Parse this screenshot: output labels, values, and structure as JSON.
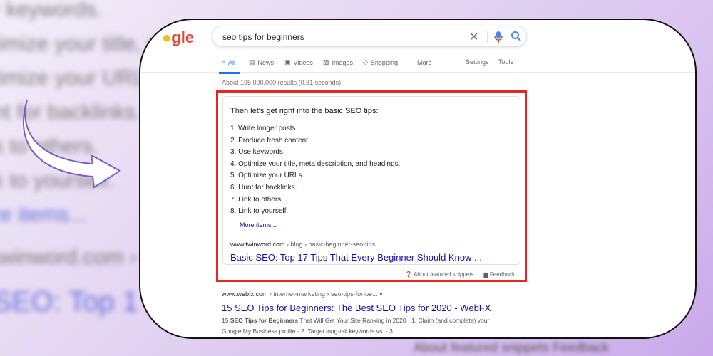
{
  "background": {
    "lines": [
      "r keywords.",
      "timize your title, m",
      "timize your URLs.",
      "nt for backlinks.",
      "k to others.",
      "k to yourself."
    ],
    "more": "re items...",
    "cite": "twinword.com › blo",
    "title": "SEO: Top 1",
    "bottom": "About featured snippets   Feedback"
  },
  "logo": "gle",
  "search": {
    "query": "seo tips for beginners"
  },
  "tabs": [
    {
      "label": "All",
      "icon": "search-icon"
    },
    {
      "label": "News",
      "icon": "news-icon"
    },
    {
      "label": "Videos",
      "icon": "video-icon"
    },
    {
      "label": "Images",
      "icon": "image-icon"
    },
    {
      "label": "Shopping",
      "icon": "tag-icon"
    },
    {
      "label": "More",
      "icon": "more-vert-icon"
    }
  ],
  "settings": "Settings",
  "tools": "Tools",
  "stats": "About 195,000,000 results (0.81 seconds)",
  "snippet": {
    "heading": "Then let's get right into the basic SEO tips:",
    "items": [
      "1. Write longer posts.",
      "2. Produce fresh content.",
      "3. Use keywords.",
      "4. Optimize your title, meta description, and headings.",
      "5. Optimize your URLs.",
      "6. Hunt for backlinks.",
      "7. Link to others.",
      "8. Link to yourself."
    ],
    "more": "More items...",
    "domain": "www.twinword.com",
    "path": " › blog › basic-beginner-seo-tips",
    "title": "Basic SEO: Top 17 Tips That Every Beginner Should Know ...",
    "about": "About featured snippets",
    "feedback": "Feedback",
    "highlight_color": "#e8261f"
  },
  "result2": {
    "domain": "www.webfx.com",
    "path": " › internet-marketing › seo-tips-for-be... ▾",
    "title": "15 SEO Tips for Beginners: The Best SEO Tips for 2020 - WebFX",
    "snippet_pre": "15 ",
    "snippet_bold": "SEO Tips for Beginners",
    "snippet_post": " That Will Get Your Site Ranking in 2020 · 1. Claim (and complete) your Google My Business profile · 2. Target long-tail keywords vs. · 3."
  }
}
